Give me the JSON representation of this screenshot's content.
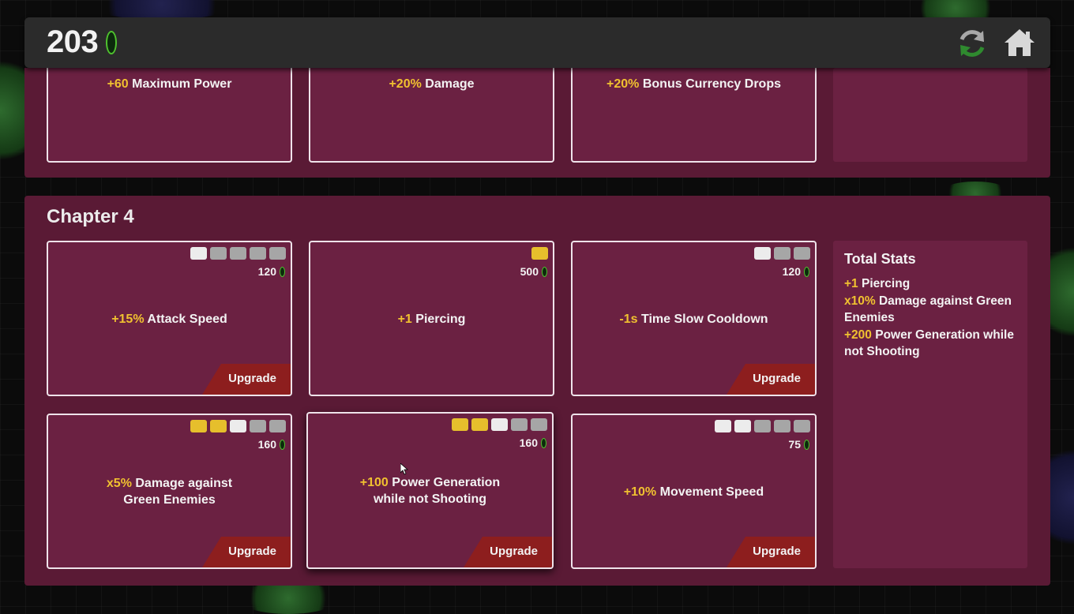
{
  "header": {
    "currency_amount": "203",
    "refresh_icon": "refresh-icon",
    "home_icon": "home-icon"
  },
  "previous_chapter": {
    "upgrades": [
      {
        "value": "+60",
        "label": "Maximum Power"
      },
      {
        "value": "+20%",
        "label": "Damage"
      },
      {
        "value": "+20%",
        "label": "Bonus Currency Drops"
      }
    ]
  },
  "chapter": {
    "title": "Chapter 4",
    "upgrades": [
      {
        "value": "+15%",
        "label": "Attack Speed",
        "cost": "120",
        "levels_bought": 0,
        "levels_total": 5,
        "button": "Upgrade"
      },
      {
        "value": "+1",
        "label": "Piercing",
        "cost": "500",
        "levels_bought": 1,
        "levels_total": 1,
        "button": ""
      },
      {
        "value": "-1s",
        "label": "Time Slow Cooldown",
        "cost": "120",
        "levels_bought": 0,
        "levels_total": 3,
        "button": "Upgrade"
      },
      {
        "value": "x5%",
        "label": "Damage against",
        "label2": "Green Enemies",
        "cost": "160",
        "levels_bought": 2,
        "levels_total": 5,
        "button": "Upgrade"
      },
      {
        "value": "+100",
        "label": "Power Generation",
        "label2": "while not Shooting",
        "cost": "160",
        "levels_bought": 2,
        "levels_total": 5,
        "button": "Upgrade"
      },
      {
        "value": "+10%",
        "label": "Movement Speed",
        "cost": "75",
        "levels_bought": 0,
        "levels_total": 5,
        "button": "Upgrade"
      }
    ],
    "total_stats": {
      "title": "Total Stats",
      "lines": [
        {
          "value": "+1",
          "label": "Piercing"
        },
        {
          "value": "x10%",
          "label": "Damage against Green Enemies"
        },
        {
          "value": "+200",
          "label": "Power Generation while not Shooting"
        }
      ]
    }
  },
  "colors": {
    "highlight": "#f0c130",
    "panel": "#5a1a35",
    "card": "#6b2142",
    "upgrade_button": "#8d1e1e",
    "currency_green": "#4fc22e",
    "pip_bought": "#e6bf2c",
    "pip_next": "#ececec",
    "pip_empty": "#a6a6a6"
  }
}
